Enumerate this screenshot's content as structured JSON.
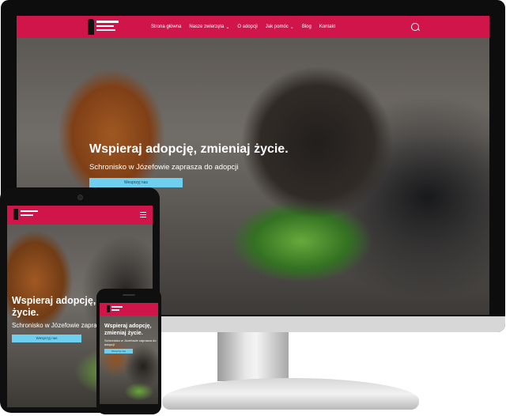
{
  "desktop": {
    "nav": {
      "items": [
        {
          "label": "Strona główna",
          "has_dropdown": false
        },
        {
          "label": "Nasze zwierzęta",
          "has_dropdown": true
        },
        {
          "label": "O adopcji",
          "has_dropdown": false
        },
        {
          "label": "Jak pomóc",
          "has_dropdown": true
        },
        {
          "label": "Blog",
          "has_dropdown": false
        },
        {
          "label": "Kontakt",
          "has_dropdown": false
        }
      ],
      "search_icon": "search-icon"
    },
    "hero": {
      "title": "Wspieraj adopcję, zmieniaj życie.",
      "subtitle": "Schronisko w Józefowie zaprasza do adopcji",
      "cta": "Wesprzyj nas"
    }
  },
  "tablet": {
    "hero": {
      "title": "Wspieraj adopcję, zmieniaj życie.",
      "subtitle": "Schronisko w Józefowie zaprasza",
      "cta": "Wesprzyj nas"
    },
    "menu_icon": "hamburger-icon"
  },
  "phone": {
    "hero": {
      "title": "Wspieraj adopcję, zmieniaj życie.",
      "subtitle": "Schronisko w Józefowie zaprasza do adopcji",
      "cta": "Wesprzyj nas"
    }
  },
  "colors": {
    "brand_red": "#d0154b",
    "cta_blue": "#6ecfee",
    "text_light": "#ffffff"
  }
}
